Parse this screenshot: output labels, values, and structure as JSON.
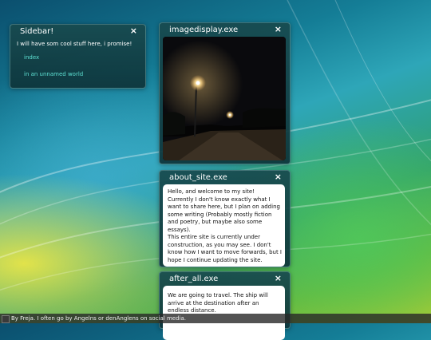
{
  "sidebar": {
    "title": "Sidebar!",
    "close": "×",
    "text": "I will have som cool stuff here, i promise!",
    "links": [
      "index",
      "in an unnamed world"
    ]
  },
  "image_window": {
    "title": "imagedisplay.exe",
    "close": "×"
  },
  "about_window": {
    "title": "about_site.exe",
    "close": "×",
    "paragraphs": [
      "Hello, and welcome to my site! Currently I don't know exactly what I want to share here, but I plan on adding some writing (Probably mostly fiction and poetry, but maybe also some essays).",
      "This entire site is currently under construction, as you may see. I don't know how I want to move forwards, but I hope I continue updating the site."
    ]
  },
  "after_window": {
    "title": "after_all.exe",
    "close": "×",
    "text": "We are going to travel. The ship will arrive at the destination after an endless distance."
  },
  "footer": {
    "text": "By Freja. I often go by Angelns or denAnglens on social media."
  },
  "colors": {
    "window_bg": "#184a4e",
    "link": "#5de0d2"
  }
}
